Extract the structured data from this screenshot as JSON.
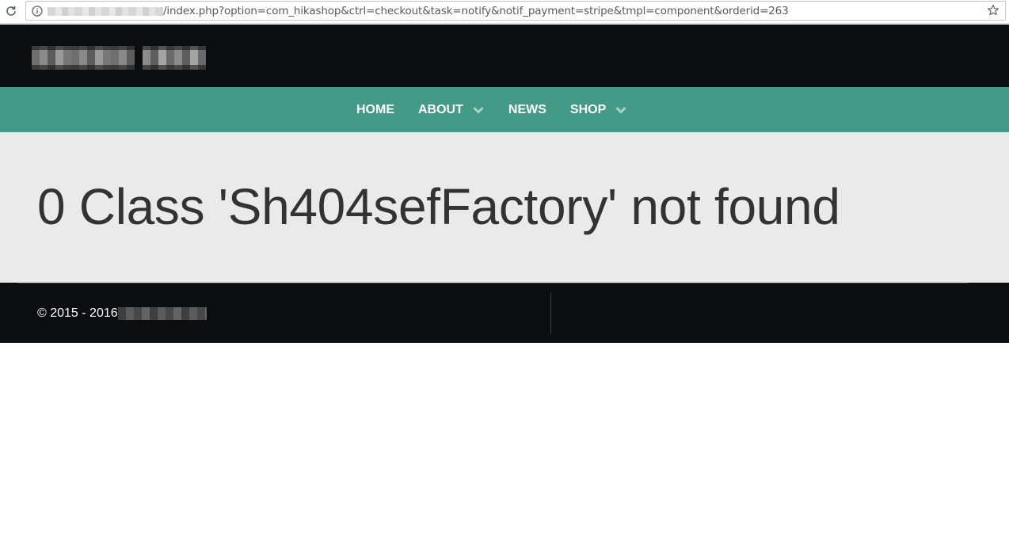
{
  "browser": {
    "url_path": "/index.php?option=com_hikashop&ctrl=checkout&task=notify&notif_payment=stripe&tmpl=component&orderid=263",
    "icons": [
      "reload-icon",
      "info-icon",
      "star-icon"
    ]
  },
  "nav": {
    "items": [
      {
        "label": "HOME",
        "has_dropdown": false
      },
      {
        "label": "ABOUT",
        "has_dropdown": true
      },
      {
        "label": "NEWS",
        "has_dropdown": false
      },
      {
        "label": "SHOP",
        "has_dropdown": true
      }
    ]
  },
  "main": {
    "error_title": "0 Class 'Sh404sefFactory' not found"
  },
  "footer": {
    "copyright": "© 2015 - 2016"
  },
  "colors": {
    "header_bg": "#0b0e11",
    "nav_bg": "#439a86",
    "content_bg": "#eaeaea",
    "title_text": "#333333",
    "chevron": "#a9d3c8"
  }
}
